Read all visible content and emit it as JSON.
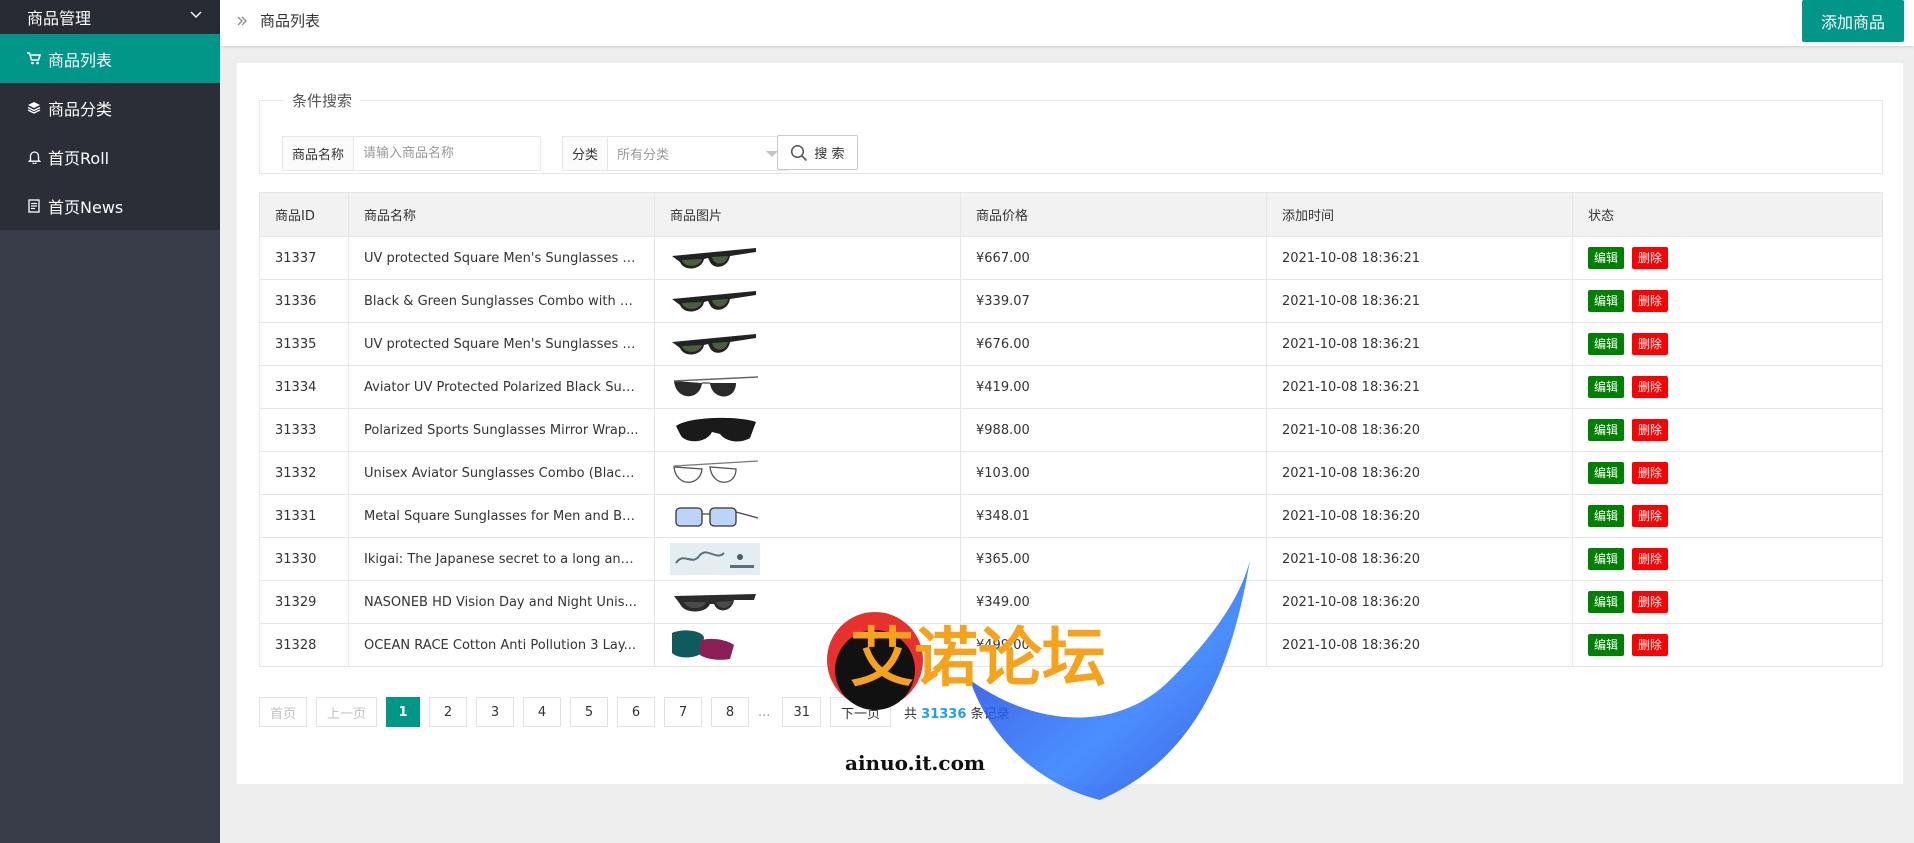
{
  "sidebar": {
    "group_label": "商品管理",
    "items": [
      {
        "label": "商品列表",
        "icon": "cart-icon",
        "active": true
      },
      {
        "label": "商品分类",
        "icon": "layers-icon",
        "active": false
      },
      {
        "label": "首页Roll",
        "icon": "bell-icon",
        "active": false
      },
      {
        "label": "首页News",
        "icon": "document-icon",
        "active": false
      }
    ]
  },
  "header": {
    "breadcrumb": "商品列表",
    "add_button": "添加商品"
  },
  "search": {
    "legend": "条件搜索",
    "name_label": "商品名称",
    "name_placeholder": "请输入商品名称",
    "category_label": "分类",
    "category_value": "所有分类",
    "search_button": "搜 索"
  },
  "table": {
    "columns": [
      "商品ID",
      "商品名称",
      "商品图片",
      "商品价格",
      "添加时间",
      "状态"
    ],
    "edit_label": "编辑",
    "delete_label": "删除",
    "rows": [
      {
        "id": "31337",
        "name": "UV protected Square Men's Sunglasses (...",
        "image": "sunglasses",
        "price": "¥667.00",
        "time": "2021-10-08 18:36:21"
      },
      {
        "id": "31336",
        "name": "Black & Green Sunglasses Combo with U...",
        "image": "sunglasses",
        "price": "¥339.07",
        "time": "2021-10-08 18:36:21"
      },
      {
        "id": "31335",
        "name": "UV protected Square Men's Sunglasses (...",
        "image": "sunglasses",
        "price": "¥676.00",
        "time": "2021-10-08 18:36:21"
      },
      {
        "id": "31334",
        "name": "Aviator UV Protected Polarized Black Sun...",
        "image": "aviator",
        "price": "¥419.00",
        "time": "2021-10-08 18:36:21"
      },
      {
        "id": "31333",
        "name": "Polarized Sports Sunglasses Mirror Wrap...",
        "image": "sport",
        "price": "¥988.00",
        "time": "2021-10-08 18:36:20"
      },
      {
        "id": "31332",
        "name": "Unisex Aviator Sunglasses Combo (Black,...",
        "image": "aviator-clear",
        "price": "¥103.00",
        "time": "2021-10-08 18:36:20"
      },
      {
        "id": "31331",
        "name": "Metal Square Sunglasses for Men and Bo...",
        "image": "blue-glasses",
        "price": "¥348.01",
        "time": "2021-10-08 18:36:20"
      },
      {
        "id": "31330",
        "name": "Ikigai: The Japanese secret to a long and ...",
        "image": "book",
        "price": "¥365.00",
        "time": "2021-10-08 18:36:20"
      },
      {
        "id": "31329",
        "name": "NASONEB HD Vision Day and Night Unis...",
        "image": "wrap",
        "price": "¥349.00",
        "time": "2021-10-08 18:36:20"
      },
      {
        "id": "31328",
        "name": "OCEAN RACE Cotton Anti Pollution 3 Lay...",
        "image": "mask",
        "price": "¥499.00",
        "time": "2021-10-08 18:36:20"
      }
    ]
  },
  "pagination": {
    "first": "首页",
    "prev": "上一页",
    "pages": [
      "1",
      "2",
      "3",
      "4",
      "5",
      "6",
      "7",
      "8"
    ],
    "current": "1",
    "ellipsis": "...",
    "last_page": "31",
    "next": "下一页",
    "total_prefix": "共",
    "total": "31336",
    "total_suffix": "条记录"
  },
  "watermark": {
    "title": "艾诺论坛",
    "url": "ainuo.it.com"
  },
  "colors": {
    "accent": "#009688",
    "sidebar_bg": "#393d49",
    "edit": "#008000",
    "delete": "#ff0000"
  }
}
